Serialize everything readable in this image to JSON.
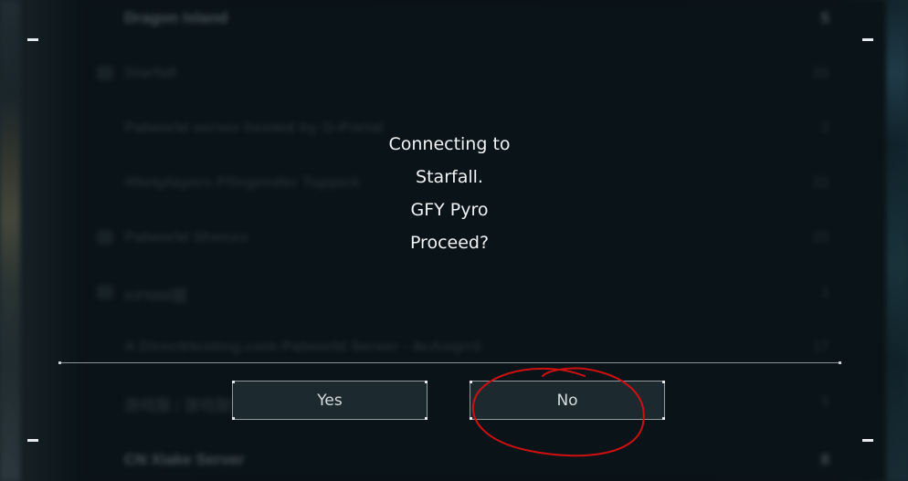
{
  "background_list": [
    {
      "name": "Dragon Island",
      "count": "5",
      "locked": false,
      "bright": true
    },
    {
      "name": "Starfall",
      "count": "20",
      "locked": true,
      "bright": false
    },
    {
      "name": "Palworld server hosted by G-Portal",
      "count": "3",
      "locked": false,
      "bright": false
    },
    {
      "name": "4Netplayers Pfingender Toppick",
      "count": "22",
      "locked": false,
      "bright": false
    },
    {
      "name": "Palworld Shenzo",
      "count": "25",
      "locked": true,
      "bright": false
    },
    {
      "name": "KPMM服",
      "count": "1",
      "locked": true,
      "bright": false
    },
    {
      "name": "A DirectHosting.com Palworld Server - 8cAoqrr3",
      "count": "17",
      "locked": false,
      "bright": false
    },
    {
      "name": "游戏服 / 游戏服务器",
      "count": "3",
      "locked": false,
      "bright": false
    },
    {
      "name": "CN Xiake Server",
      "count": "8",
      "locked": false,
      "bright": true
    }
  ],
  "dialog": {
    "message_lines": [
      "Connecting to",
      "Starfall.",
      "GFY Pyro",
      "Proceed?"
    ],
    "yes_label": "Yes",
    "no_label": "No"
  },
  "colors": {
    "annotation": "#d01010",
    "dialog_text": "#f2f4f5",
    "button_border": "#8f999e"
  }
}
